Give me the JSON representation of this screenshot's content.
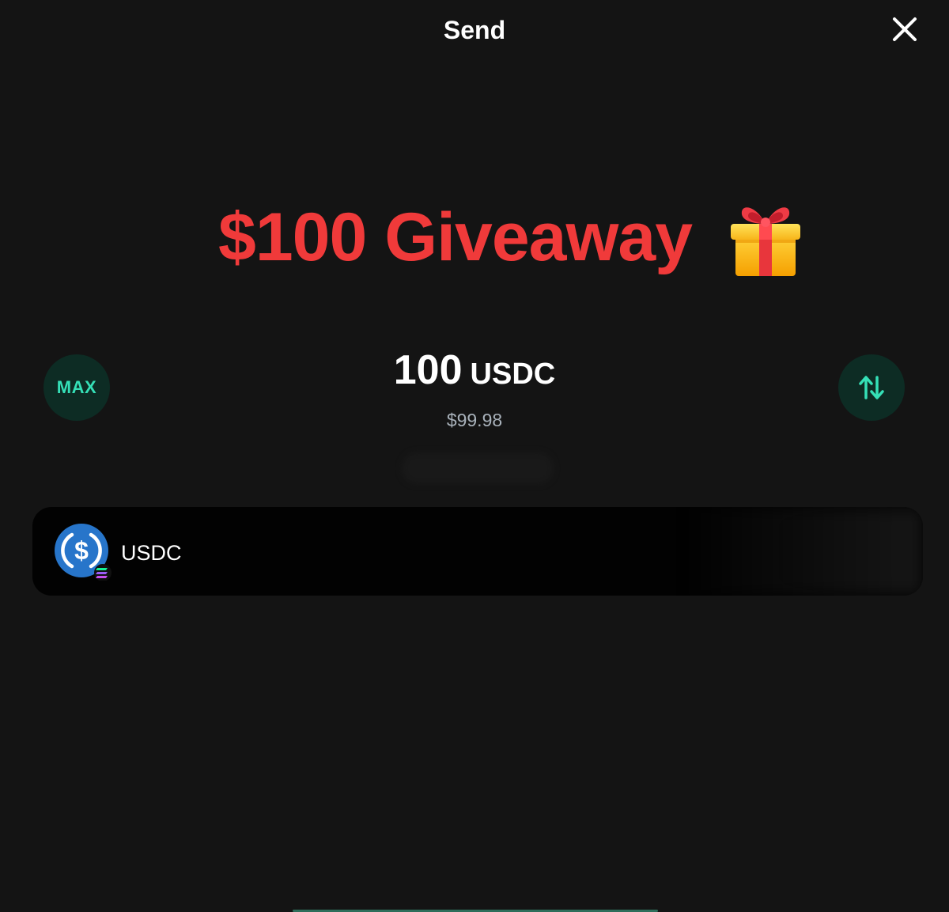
{
  "header": {
    "title": "Send"
  },
  "promo": {
    "text": "$100 Giveaway",
    "icon": "gift-icon"
  },
  "amount": {
    "max_label": "MAX",
    "value": "100",
    "unit": "USDC",
    "fiat": "$99.98",
    "swap_icon": "swap-arrows-icon"
  },
  "token": {
    "name": "USDC",
    "icon": "usdc-icon",
    "network_badge": "solana-badge-icon"
  },
  "colors": {
    "background": "#141414",
    "accent": "#35e0b7",
    "accent_button_bg": "#0d2c24",
    "promo_red": "#f03a3a",
    "card_bg": "#020202",
    "usdc_blue": "#2775ca"
  }
}
